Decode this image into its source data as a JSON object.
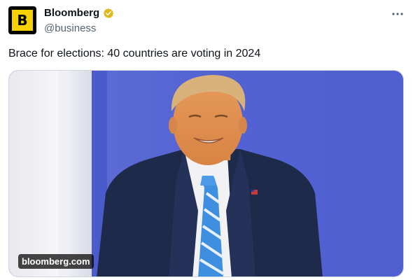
{
  "account": {
    "display_name": "Bloomberg",
    "handle": "@business",
    "avatar_letter": "B",
    "avatar_color": "#f5d100",
    "verified": true,
    "verified_badge_color": "#e2b719"
  },
  "menu": {
    "icon": "more-horizontal-icon"
  },
  "tweet": {
    "text": "Brace for elections: 40 countries are voting in 2024"
  },
  "media": {
    "source_label": "bloomberg.com",
    "background_color": "#5566d4"
  }
}
